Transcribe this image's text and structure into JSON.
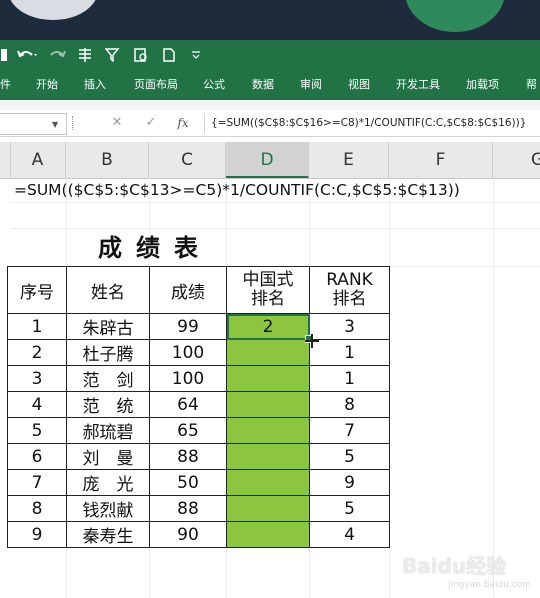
{
  "ribbon": {
    "tabs": [
      "件",
      "开始",
      "插入",
      "页面布局",
      "公式",
      "数据",
      "审阅",
      "视图",
      "开发工具",
      "加载项",
      "帮"
    ]
  },
  "formula_bar": {
    "formula": "{=SUM(($C$8:$C$16>=C8)*1/COUNTIF(C:C,$C$8:$C$16))}",
    "fx_label": "fx"
  },
  "column_headers": [
    "A",
    "B",
    "C",
    "D",
    "E",
    "F",
    "G"
  ],
  "sheet": {
    "formula_display": "=SUM(($C$5:$C$13>=C5)*1/COUNTIF(C:C,$C$5:$C$13))",
    "table_title": "成绩表",
    "header": {
      "seq": "序号",
      "name": "姓名",
      "score": "成绩",
      "cn_rank_line1": "中国式",
      "cn_rank_line2": "排名",
      "rank_line1": "RANK",
      "rank_line2": "排名"
    },
    "rows": [
      {
        "seq": "1",
        "name": "朱辟古",
        "score": "99",
        "cn_rank": "2",
        "rank": "3"
      },
      {
        "seq": "2",
        "name": "杜子腾",
        "score": "100",
        "cn_rank": "",
        "rank": "1"
      },
      {
        "seq": "3",
        "name": "范　剑",
        "score": "100",
        "cn_rank": "",
        "rank": "1"
      },
      {
        "seq": "4",
        "name": "范　统",
        "score": "64",
        "cn_rank": "",
        "rank": "8"
      },
      {
        "seq": "5",
        "name": "郝琉碧",
        "score": "65",
        "cn_rank": "",
        "rank": "7"
      },
      {
        "seq": "6",
        "name": "刘　曼",
        "score": "88",
        "cn_rank": "",
        "rank": "5"
      },
      {
        "seq": "7",
        "name": "庞　光",
        "score": "50",
        "cn_rank": "",
        "rank": "9"
      },
      {
        "seq": "8",
        "name": "钱烈献",
        "score": "88",
        "cn_rank": "",
        "rank": "5"
      },
      {
        "seq": "9",
        "name": "秦寿生",
        "score": "90",
        "cn_rank": "",
        "rank": "4"
      }
    ]
  },
  "watermark": {
    "text": "Baidu经验",
    "sub": "jingyan.baidu.com"
  },
  "colors": {
    "ribbon_green": "#217346",
    "highlight_green": "#8cc63f"
  }
}
